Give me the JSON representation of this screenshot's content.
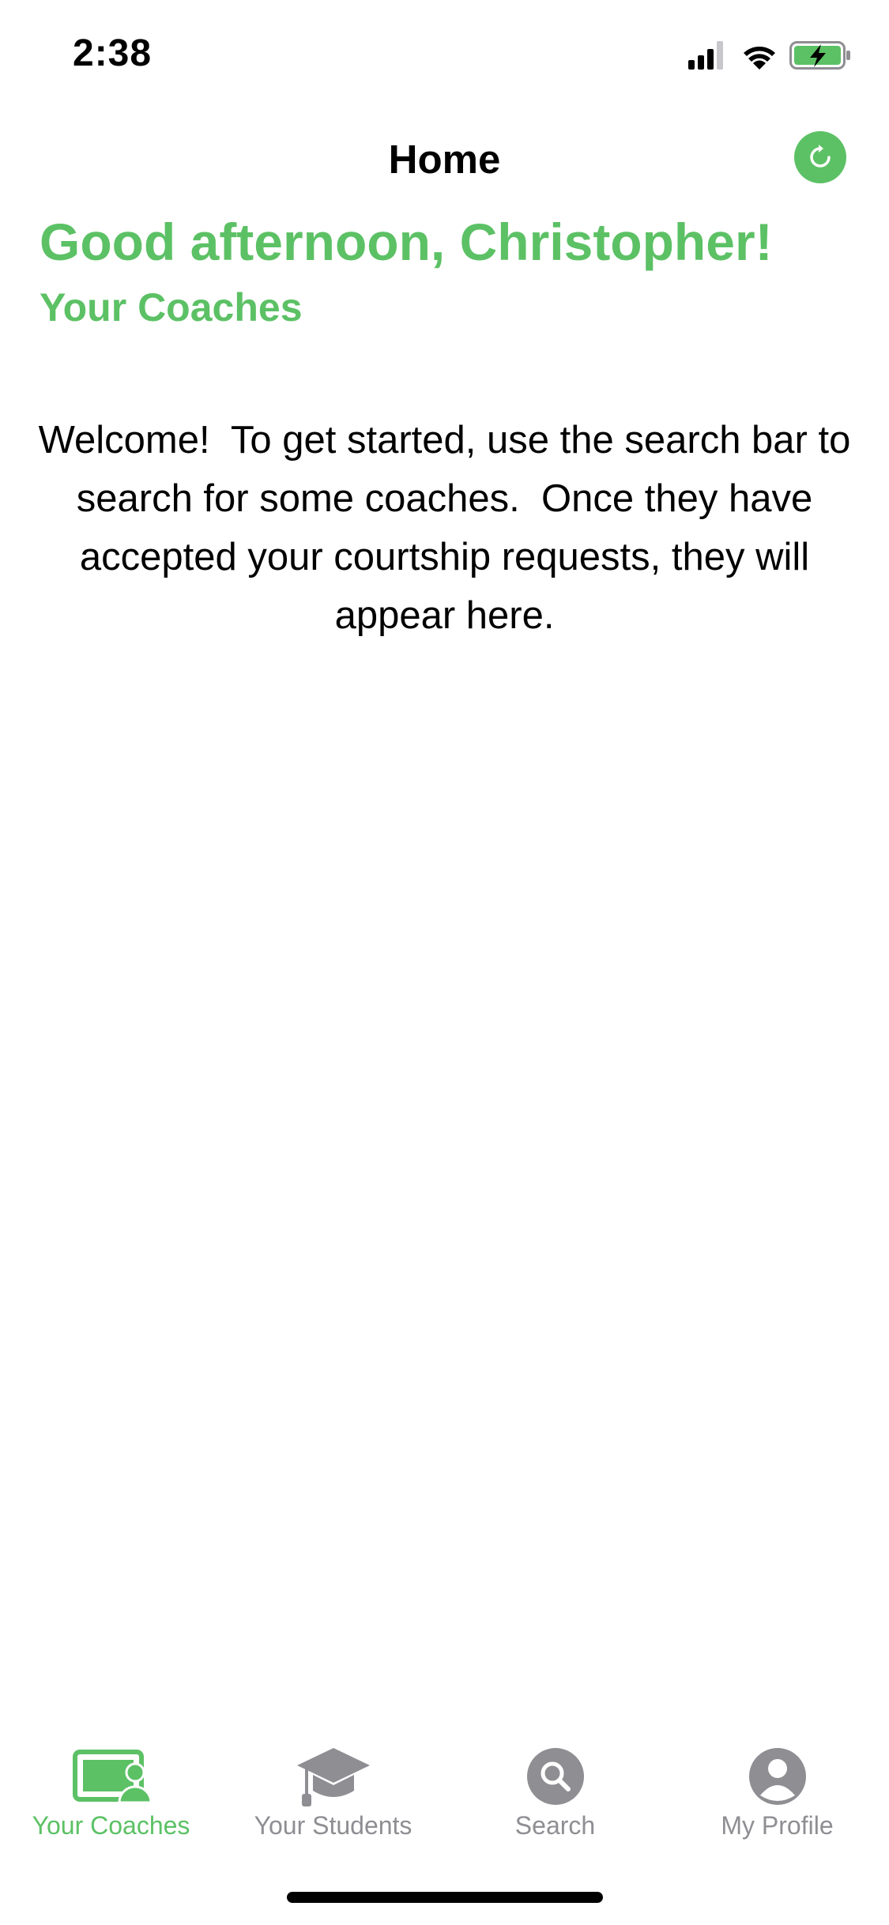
{
  "status_bar": {
    "time": "2:38",
    "icons": [
      "signal-icon",
      "wifi-icon",
      "battery-charging-icon"
    ]
  },
  "nav": {
    "title": "Home",
    "refresh_icon": "refresh-icon"
  },
  "greeting": "Good afternoon, Christopher!",
  "section_title": "Your Coaches",
  "welcome_text": "Welcome!  To get started, use the search bar to search for some coaches.  Once they have accepted your courtship requests, they will appear here.",
  "tab_bar": {
    "items": [
      {
        "label": "Your Coaches",
        "icon": "coach-board-icon",
        "active": true
      },
      {
        "label": "Your Students",
        "icon": "graduation-cap-icon",
        "active": false
      },
      {
        "label": "Search",
        "icon": "search-icon",
        "active": false
      },
      {
        "label": "My Profile",
        "icon": "profile-icon",
        "active": false
      }
    ]
  },
  "colors": {
    "accent": "#5CC165",
    "inactive": "#8e8e93",
    "text": "#000000",
    "background": "#ffffff"
  }
}
